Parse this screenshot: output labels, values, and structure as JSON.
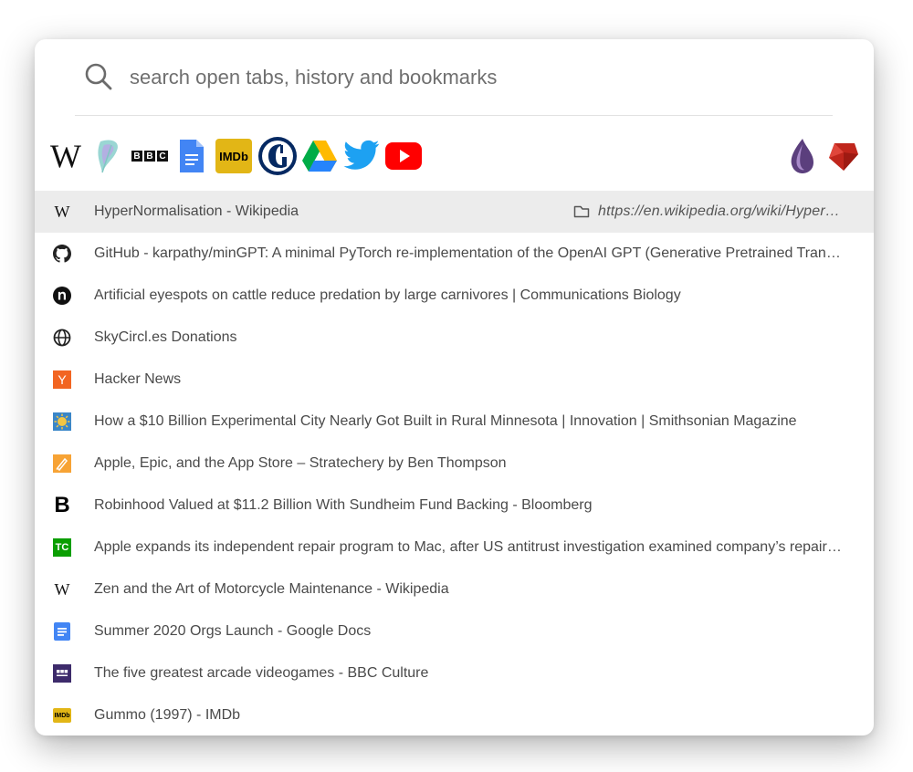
{
  "search": {
    "placeholder": "search open tabs, history and bookmarks",
    "icon": "search-icon"
  },
  "bookmarks": {
    "left": [
      {
        "name": "Wikipedia",
        "icon": "wikipedia-icon"
      },
      {
        "name": "Feather",
        "icon": "feather-icon"
      },
      {
        "name": "BBC",
        "icon": "bbc-icon",
        "text": "BBC"
      },
      {
        "name": "Google Docs",
        "icon": "google-docs-icon"
      },
      {
        "name": "IMDb",
        "icon": "imdb-icon",
        "text": "IMDb"
      },
      {
        "name": "The Guardian",
        "icon": "guardian-icon"
      },
      {
        "name": "Google Drive",
        "icon": "google-drive-icon"
      },
      {
        "name": "Twitter",
        "icon": "twitter-icon"
      },
      {
        "name": "YouTube",
        "icon": "youtube-icon"
      }
    ],
    "right": [
      {
        "name": "Elixir",
        "icon": "elixir-icon"
      },
      {
        "name": "Ruby",
        "icon": "ruby-icon"
      }
    ]
  },
  "results": [
    {
      "title": "HyperNormalisation - Wikipedia",
      "icon": "wikipedia-icon",
      "selected": true,
      "url": "https://en.wikipedia.org/wiki/HyperNormalisation"
    },
    {
      "title": "GitHub - karpathy/minGPT: A minimal PyTorch re-implementation of the OpenAI GPT (Generative Pretrained Transformer) training",
      "icon": "github-icon"
    },
    {
      "title": "Artificial eyespots on cattle reduce predation by large carnivores | Communications Biology",
      "icon": "nature-icon"
    },
    {
      "title": "SkyCircl.es Donations",
      "icon": "globe-icon"
    },
    {
      "title": "Hacker News",
      "icon": "hacker-news-icon",
      "badge": "Y"
    },
    {
      "title": "How a $10 Billion Experimental City Nearly Got Built in Rural Minnesota | Innovation | Smithsonian Magazine",
      "icon": "smithsonian-icon"
    },
    {
      "title": "Apple, Epic, and the App Store – Stratechery by Ben Thompson",
      "icon": "stratechery-icon"
    },
    {
      "title": "Robinhood Valued at $11.2 Billion With Sundheim Fund Backing - Bloomberg",
      "icon": "bloomberg-icon",
      "badge": "B"
    },
    {
      "title": "Apple expands its independent repair program to Mac, after US antitrust investigation examined company’s repair policies",
      "icon": "techcrunch-icon",
      "badge": "TC"
    },
    {
      "title": "Zen and the Art of Motorcycle Maintenance - Wikipedia",
      "icon": "wikipedia-icon"
    },
    {
      "title": "Summer 2020 Orgs Launch - Google Docs",
      "icon": "google-docs-icon"
    },
    {
      "title": "The five greatest arcade videogames - BBC Culture",
      "icon": "bbc-culture-icon"
    },
    {
      "title": "Gummo (1997) - IMDb",
      "icon": "imdb-icon",
      "badge": "IMDb"
    }
  ],
  "colors": {
    "selected_row": "#ececec",
    "text": "#4a4a4a",
    "hacker_news": "#f26522",
    "techcrunch": "#0a9e01",
    "youtube": "#ff0000",
    "twitter": "#1da1f2",
    "imdb": "#e2b616"
  },
  "wiki_glyph": "W"
}
